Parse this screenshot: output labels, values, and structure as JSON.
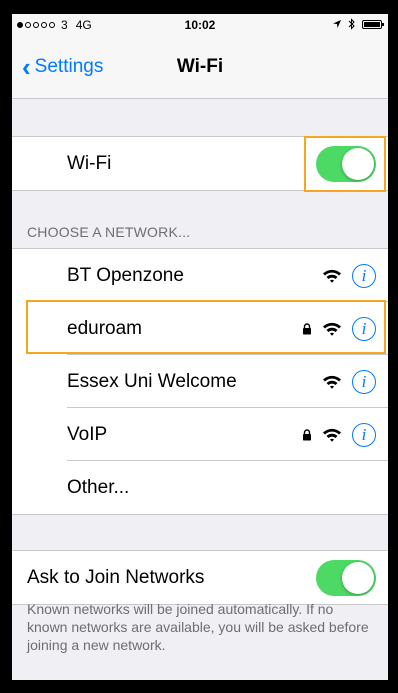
{
  "status_bar": {
    "signal_dots": [
      true,
      false,
      false,
      false,
      false
    ],
    "carrier": "3",
    "network_type": "4G",
    "time": "10:02",
    "icons": [
      "location-arrow-icon",
      "bluetooth-icon",
      "battery-icon"
    ]
  },
  "nav": {
    "back_label": "Settings",
    "title": "Wi-Fi"
  },
  "wifi_toggle": {
    "label": "Wi-Fi",
    "on": true
  },
  "networks_header": "CHOOSE A NETWORK...",
  "networks": [
    {
      "name": "BT Openzone",
      "secured": false
    },
    {
      "name": "eduroam",
      "secured": true
    },
    {
      "name": "Essex Uni Welcome",
      "secured": false
    },
    {
      "name": "VoIP",
      "secured": true
    }
  ],
  "other_label": "Other...",
  "ask_to_join": {
    "label": "Ask to Join Networks",
    "on": true,
    "footer": "Known networks will be joined automatically. If no known networks are available, you will be asked before joining a new network."
  },
  "colors": {
    "accent": "#007aff",
    "toggle_on": "#4cd964",
    "highlight": "#f5a623"
  }
}
